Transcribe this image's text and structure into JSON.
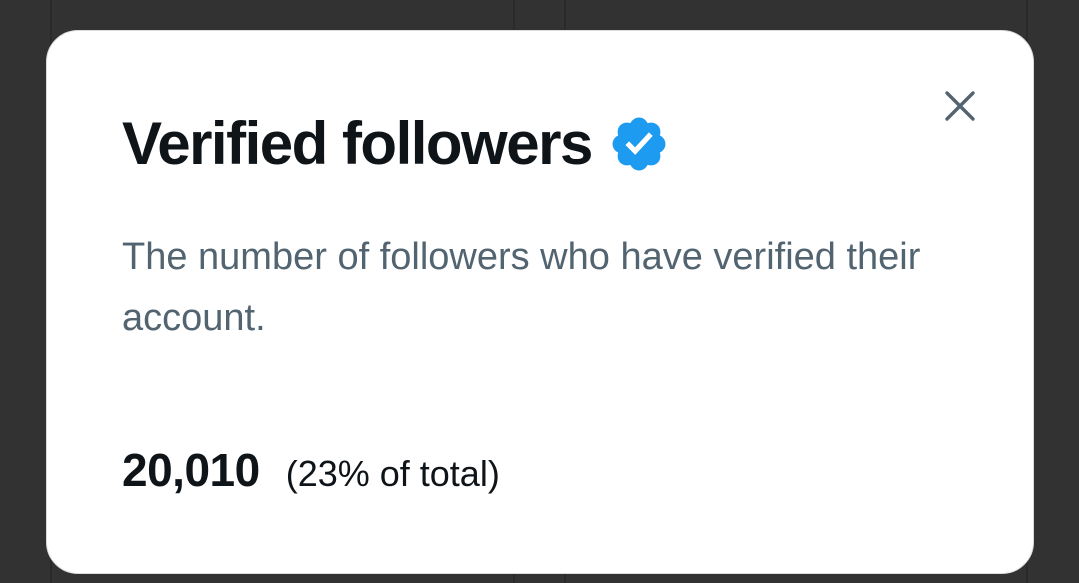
{
  "modal": {
    "title": "Verified followers",
    "badge_icon": "verified-badge-icon",
    "badge_color": "#1d9bf0",
    "description": "The number of followers who have verified their account.",
    "stat_value": "20,010",
    "stat_percent": "(23% of total)",
    "close_icon": "close-icon"
  }
}
